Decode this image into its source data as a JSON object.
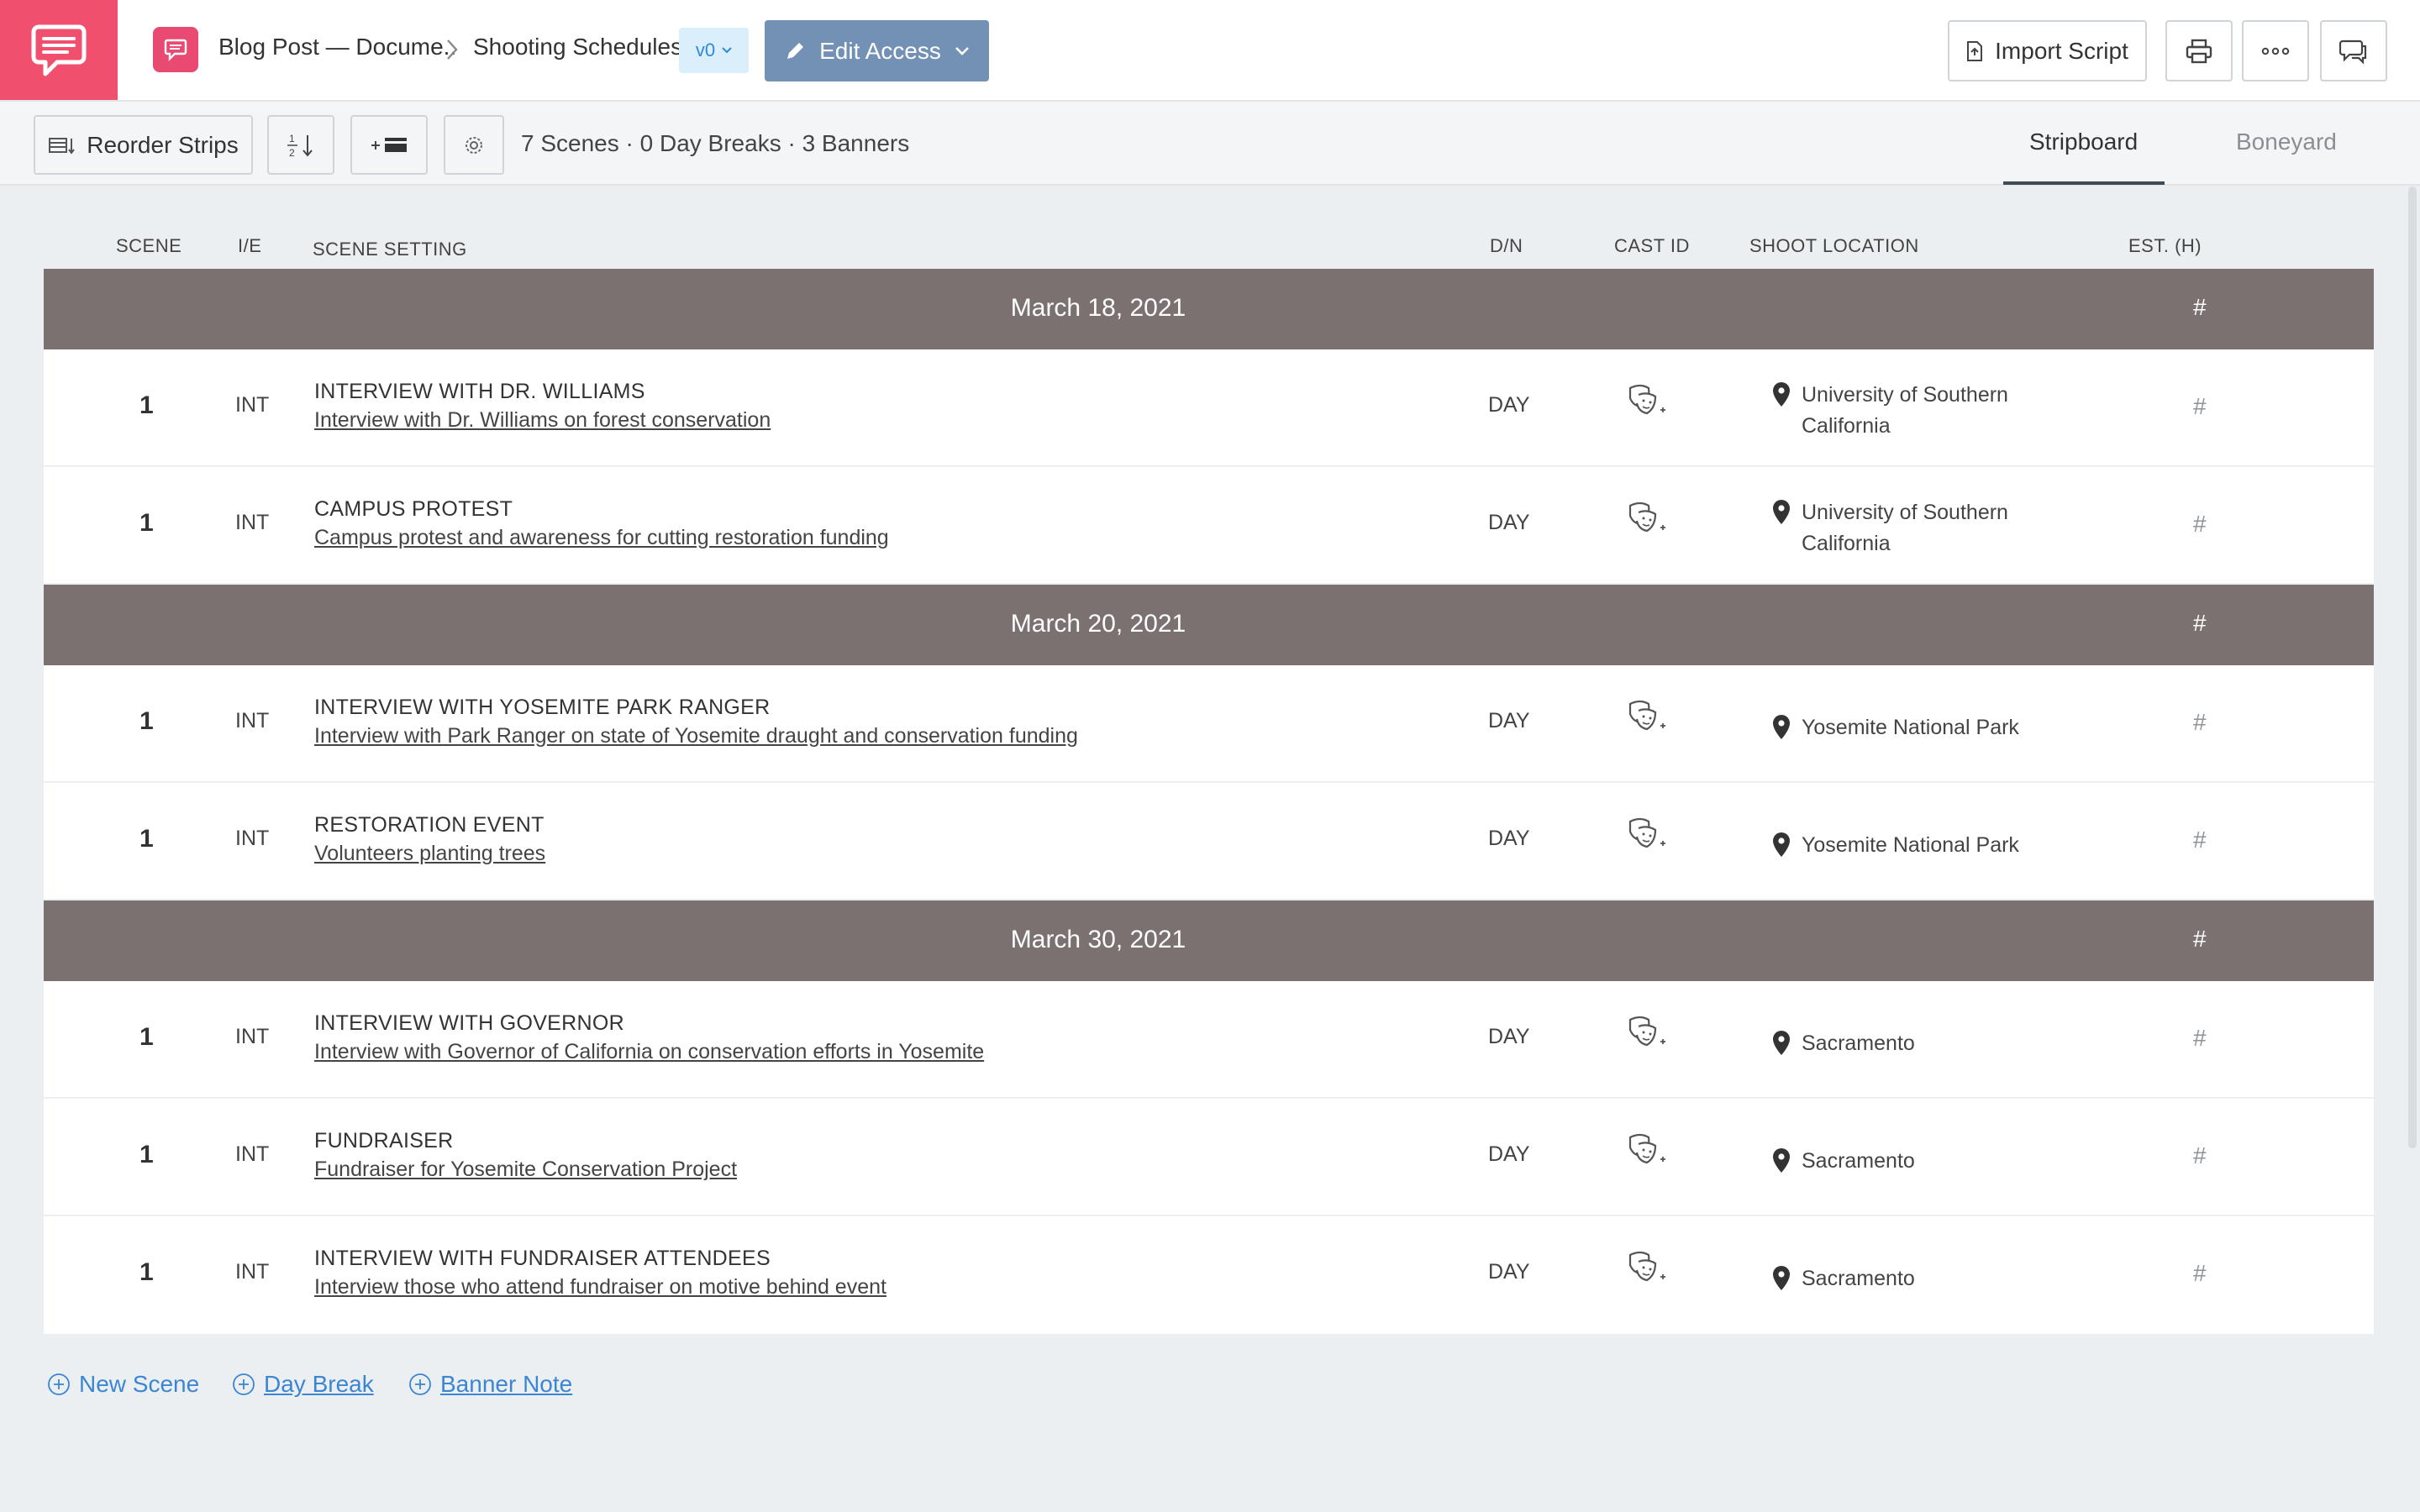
{
  "header": {
    "breadcrumb_project": "Blog Post — Docume..",
    "breadcrumb_page": "Shooting Schedules",
    "version": "v0",
    "edit_access_label": "Edit Access",
    "import_script_label": "Import Script"
  },
  "toolbar": {
    "reorder_label": "Reorder Strips",
    "summary": "7 Scenes · 0 Day Breaks · 3 Banners",
    "tabs": [
      {
        "label": "Stripboard",
        "active": true
      },
      {
        "label": "Boneyard",
        "active": false
      }
    ]
  },
  "columns": {
    "scene": "SCENE",
    "ie": "I/E",
    "setting": "SCENE SETTING",
    "dn": "D/N",
    "cast": "CAST ID",
    "location": "SHOOT LOCATION",
    "est": "EST. (H)"
  },
  "banners": [
    {
      "date": "March 18, 2021",
      "est": "#"
    },
    {
      "date": "March 20, 2021",
      "est": "#"
    },
    {
      "date": "March 30, 2021",
      "est": "#"
    }
  ],
  "scenes": [
    {
      "scene": "1",
      "ie": "INT",
      "title": "INTERVIEW WITH DR. WILLIAMS",
      "desc": "Interview with Dr. Williams on forest conservation",
      "dn": "DAY",
      "location": "University of Southern California",
      "est": "#"
    },
    {
      "scene": "1",
      "ie": "INT",
      "title": "CAMPUS PROTEST",
      "desc": "Campus protest and awareness for cutting restoration funding",
      "dn": "DAY",
      "location": "University of Southern California",
      "est": "#"
    },
    {
      "scene": "1",
      "ie": "INT",
      "title": "INTERVIEW WITH YOSEMITE PARK RANGER",
      "desc": "Interview with Park Ranger on state of Yosemite draught and conservation funding",
      "dn": "DAY",
      "location": "Yosemite National Park",
      "est": "#"
    },
    {
      "scene": "1",
      "ie": "INT",
      "title": "RESTORATION EVENT",
      "desc": "Volunteers planting trees ",
      "dn": "DAY",
      "location": "Yosemite National Park",
      "est": "#"
    },
    {
      "scene": "1",
      "ie": "INT",
      "title": "INTERVIEW WITH GOVERNOR",
      "desc": "Interview with Governor of California on conservation efforts in Yosemite",
      "dn": "DAY",
      "location": "Sacramento",
      "est": "#"
    },
    {
      "scene": "1",
      "ie": "INT",
      "title": "FUNDRAISER",
      "desc": "Fundraiser for Yosemite Conservation Project",
      "dn": "DAY",
      "location": "Sacramento",
      "est": "#"
    },
    {
      "scene": "1",
      "ie": "INT",
      "title": "INTERVIEW WITH FUNDRAISER ATTENDEES",
      "desc": "Interview those who attend fundraiser on motive behind event",
      "dn": "DAY",
      "location": "Sacramento",
      "est": "#"
    }
  ],
  "footer": {
    "new_scene": "New Scene",
    "day_break": "Day Break",
    "banner_note": "Banner Note"
  },
  "colors": {
    "brand": "#f0506e",
    "banner": "#7b7170",
    "link": "#3b86d4",
    "edit_button": "#7291b5"
  }
}
